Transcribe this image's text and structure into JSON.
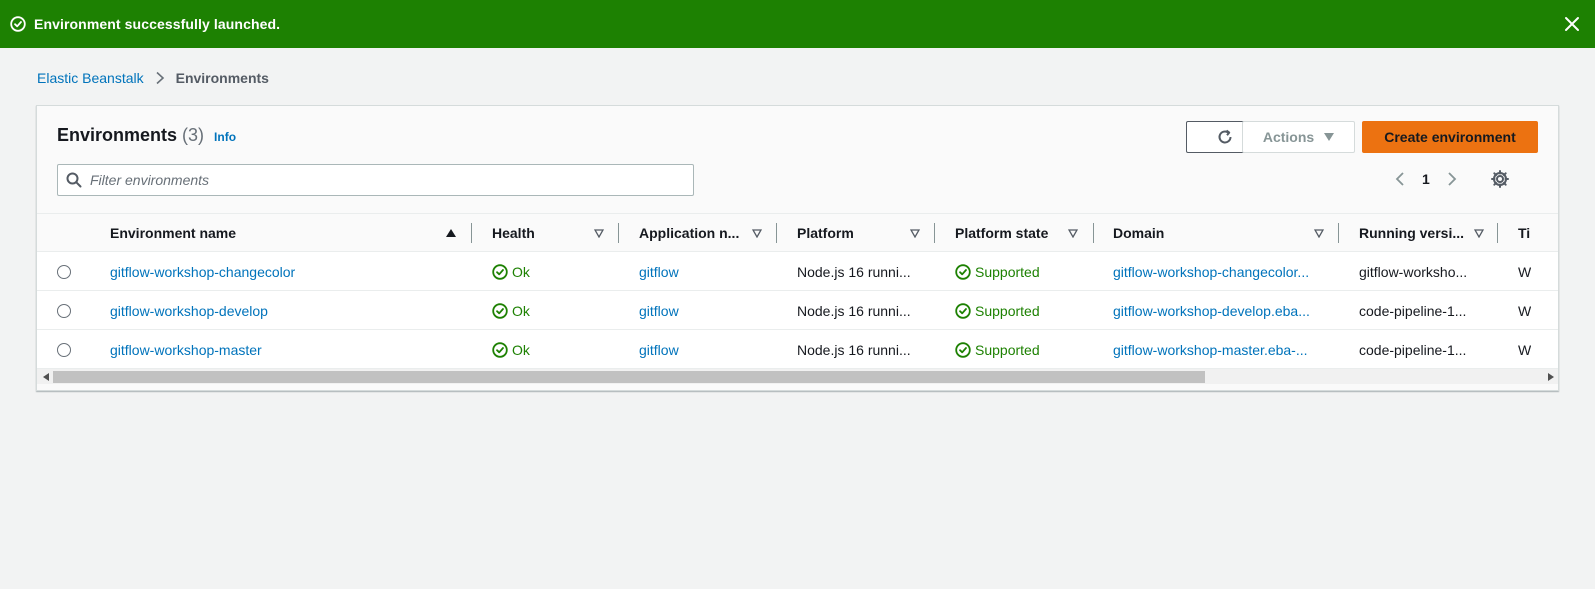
{
  "flash": {
    "message": "Environment successfully launched.",
    "color": "#1d8102"
  },
  "breadcrumb": {
    "root": "Elastic Beanstalk",
    "current": "Environments"
  },
  "panel": {
    "title": "Environments",
    "count": "(3)",
    "info": "Info",
    "actions_label": "Actions",
    "create_label": "Create environment",
    "filter_placeholder": "Filter environments",
    "page": "1"
  },
  "table": {
    "columns": [
      {
        "label": "Environment name",
        "sort": "ascending"
      },
      {
        "label": "Health"
      },
      {
        "label": "Application n..."
      },
      {
        "label": "Platform"
      },
      {
        "label": "Platform state"
      },
      {
        "label": "Domain"
      },
      {
        "label": "Running versi..."
      },
      {
        "label": "Ti"
      }
    ],
    "rows": [
      {
        "name": "gitflow-workshop-changecolor",
        "health": "Ok",
        "application": "gitflow",
        "platform": "Node.js 16 runni...",
        "platform_state": "Supported",
        "domain": "gitflow-workshop-changecolor...",
        "running_version": "gitflow-worksho...",
        "tier": "W"
      },
      {
        "name": "gitflow-workshop-develop",
        "health": "Ok",
        "application": "gitflow",
        "platform": "Node.js 16 runni...",
        "platform_state": "Supported",
        "domain": "gitflow-workshop-develop.eba...",
        "running_version": "code-pipeline-1...",
        "tier": "W"
      },
      {
        "name": "gitflow-workshop-master",
        "health": "Ok",
        "application": "gitflow",
        "platform": "Node.js 16 runni...",
        "platform_state": "Supported",
        "domain": "gitflow-workshop-master.eba-...",
        "running_version": "code-pipeline-1...",
        "tier": "W"
      }
    ]
  },
  "colors": {
    "primary": "#ec7211",
    "link": "#0073bb",
    "success": "#1d8102"
  }
}
